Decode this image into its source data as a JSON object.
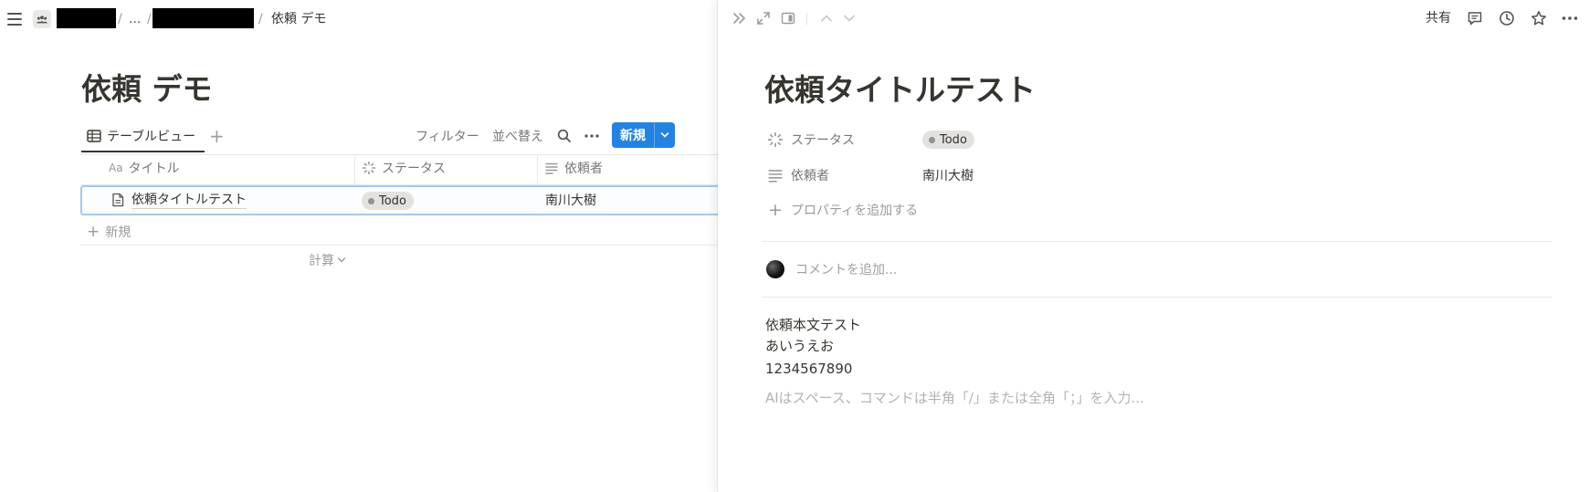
{
  "breadcrumb": {
    "ellipsis": "...",
    "separator": "/",
    "current": "依頼 デモ"
  },
  "database": {
    "title": "依頼 デモ",
    "view_tab_label": "テーブルビュー",
    "add_view": "+",
    "filter_label": "フィルター",
    "sort_label": "並べ替え",
    "new_button_label": "新規",
    "columns": [
      {
        "label": "タイトル",
        "prefix": "Aa"
      },
      {
        "label": "ステータス"
      },
      {
        "label": "依頼者"
      }
    ],
    "rows": [
      {
        "title": "依頼タイトルテスト",
        "status": "Todo",
        "requester": "南川大樹"
      }
    ],
    "add_row_label": "新規",
    "calculate_label": "計算"
  },
  "peek": {
    "share_label": "共有",
    "title": "依頼タイトルテスト",
    "properties": [
      {
        "label": "ステータス",
        "value": "Todo"
      },
      {
        "label": "依頼者",
        "value": "南川大樹"
      }
    ],
    "add_property_label": "プロパティを追加する",
    "comment_placeholder": "コメントを追加...",
    "body_lines": [
      "依頼本文テスト",
      "あいうえお",
      "1234567890"
    ],
    "body_placeholder": "AIはスペース、コマンドは半角「/」または全角「；」を入力..."
  },
  "colors": {
    "accent": "#2383e2",
    "tag_bg": "#e3e2e0",
    "text": "#37352f",
    "muted": "#787774"
  }
}
